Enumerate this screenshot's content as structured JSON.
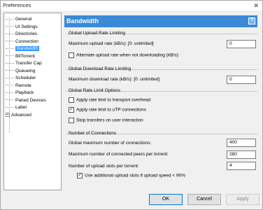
{
  "window": {
    "title": "Preferences",
    "close_glyph": "✕"
  },
  "tree": {
    "items": [
      {
        "label": "General"
      },
      {
        "label": "UI Settings"
      },
      {
        "label": "Directories"
      },
      {
        "label": "Connection"
      },
      {
        "label": "Bandwidth",
        "selected": true
      },
      {
        "label": "BitTorrent"
      },
      {
        "label": "Transfer Cap"
      },
      {
        "label": "Queueing"
      },
      {
        "label": "Scheduler"
      },
      {
        "label": "Remote"
      },
      {
        "label": "Playback"
      },
      {
        "label": "Paired Devices"
      },
      {
        "label": "Label"
      },
      {
        "label": "Advanced",
        "expandable": true
      }
    ],
    "expander_glyph": "+"
  },
  "panel": {
    "title": "Bandwidth",
    "help_glyph": "?",
    "upload": {
      "section_title": "Global Upload Rate Limiting",
      "max_label": "Maximum upload rate (kB/s): [0: unlimited]",
      "max_value": "0",
      "alt_label": "Alternate upload rate when not downloading (kB/s):",
      "alt_checked": false
    },
    "download": {
      "section_title": "Global Download Rate Limiting",
      "max_label": "Maximum download rate (kB/s): [0: unlimited]",
      "max_value": "0"
    },
    "options": {
      "section_title": "Global Rate Limit Options",
      "items": [
        {
          "label": "Apply rate limit to transport overhead",
          "checked": false
        },
        {
          "label": "Apply rate limit to uTP connections",
          "checked": true
        },
        {
          "label": "Stop transfers on user interaction",
          "checked": false
        }
      ]
    },
    "connections": {
      "section_title": "Number of Connections",
      "global_max_label": "Global maximum number of connections:",
      "global_max_value": "400",
      "per_torrent_label": "Maximum number of connected peers per torrent:",
      "per_torrent_value": "280",
      "upload_slots_label": "Number of upload slots per torrent:",
      "upload_slots_value": "4",
      "additional_slots_label": "Use additional upload slots if upload speed < 90%",
      "additional_slots_checked": true
    }
  },
  "buttons": {
    "ok": "OK",
    "cancel": "Cancel",
    "apply": "Apply"
  },
  "check_glyph": "✓"
}
